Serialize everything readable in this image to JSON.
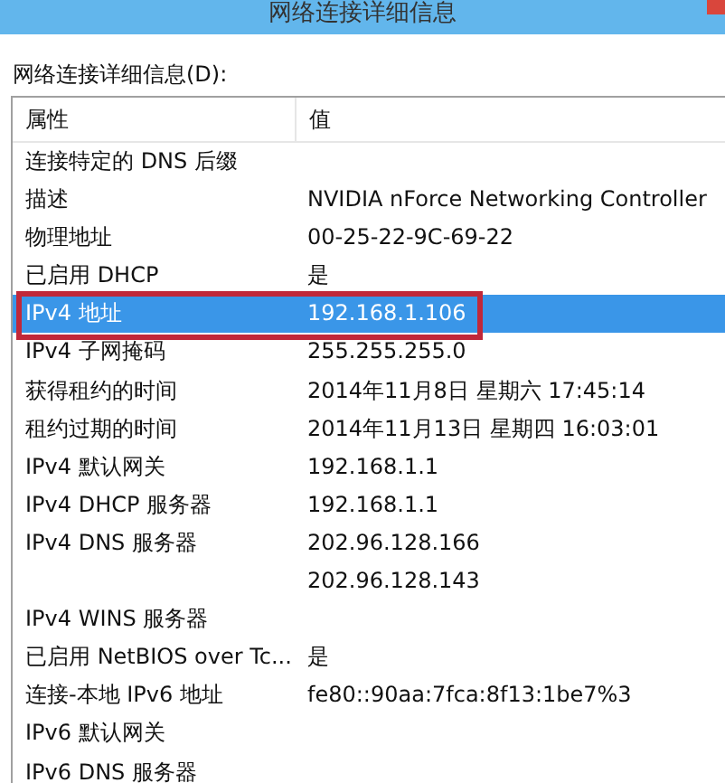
{
  "window": {
    "title": "网络连接详细信息"
  },
  "list_label": "网络连接详细信息(D):",
  "table": {
    "columns": [
      "属性",
      "值"
    ],
    "rows": [
      {
        "property": "连接特定的 DNS 后缀",
        "value": "",
        "selected": false,
        "marked": false
      },
      {
        "property": "描述",
        "value": "NVIDIA nForce Networking Controller",
        "selected": false,
        "marked": false
      },
      {
        "property": "物理地址",
        "value": "00-25-22-9C-69-22",
        "selected": false,
        "marked": false
      },
      {
        "property": "已启用 DHCP",
        "value": "是",
        "selected": false,
        "marked": false
      },
      {
        "property": "IPv4 地址",
        "value": "192.168.1.106",
        "selected": true,
        "marked": true
      },
      {
        "property": "IPv4 子网掩码",
        "value": "255.255.255.0",
        "selected": false,
        "marked": false
      },
      {
        "property": "获得租约的时间",
        "value": "2014年11月8日 星期六 17:45:14",
        "selected": false,
        "marked": false
      },
      {
        "property": "租约过期的时间",
        "value": "2014年11月13日 星期四 16:03:01",
        "selected": false,
        "marked": false
      },
      {
        "property": "IPv4 默认网关",
        "value": "192.168.1.1",
        "selected": false,
        "marked": false
      },
      {
        "property": "IPv4 DHCP 服务器",
        "value": "192.168.1.1",
        "selected": false,
        "marked": false
      },
      {
        "property": "IPv4 DNS 服务器",
        "value": "202.96.128.166",
        "selected": false,
        "marked": false
      },
      {
        "property": "",
        "value": "202.96.128.143",
        "selected": false,
        "marked": false
      },
      {
        "property": "IPv4 WINS 服务器",
        "value": "",
        "selected": false,
        "marked": false
      },
      {
        "property": "已启用 NetBIOS over Tc...",
        "value": "是",
        "selected": false,
        "marked": false
      },
      {
        "property": "连接-本地 IPv6 地址",
        "value": "fe80::90aa:7fca:8f13:1be7%3",
        "selected": false,
        "marked": false
      },
      {
        "property": "IPv6 默认网关",
        "value": "",
        "selected": false,
        "marked": false
      },
      {
        "property": "IPv6 DNS 服务器",
        "value": "",
        "selected": false,
        "marked": false
      }
    ]
  }
}
